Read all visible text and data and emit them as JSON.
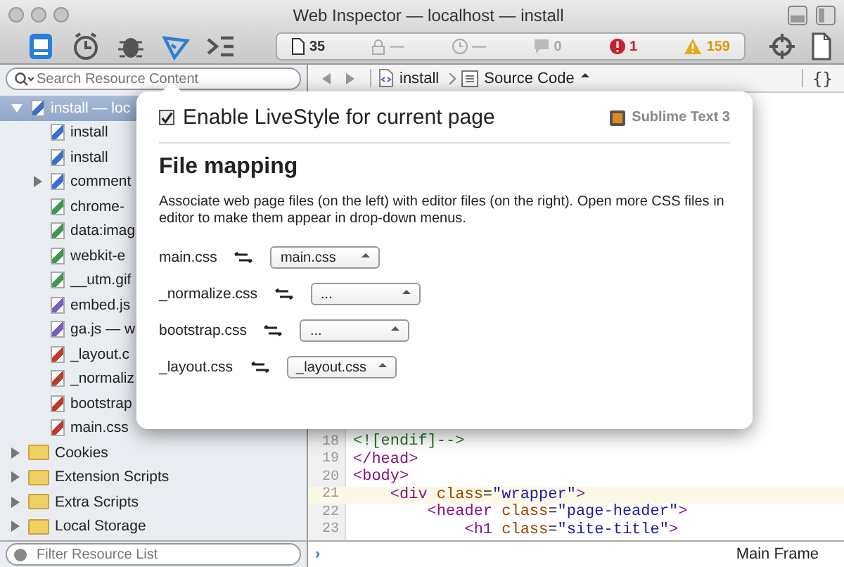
{
  "window": {
    "title": "Web Inspector — localhost — install"
  },
  "toolbar": {
    "tabs": [
      {
        "kind": "resources",
        "selected": true
      },
      {
        "kind": "timeline",
        "selected": false
      },
      {
        "kind": "debugger",
        "selected": false
      },
      {
        "kind": "livestyle",
        "selected": true
      },
      {
        "kind": "console",
        "selected": false
      }
    ],
    "counters": [
      {
        "kind": "documents",
        "text": "35"
      },
      {
        "kind": "security",
        "text": "—"
      },
      {
        "kind": "time",
        "text": "—"
      },
      {
        "kind": "logs",
        "text": "0"
      },
      {
        "kind": "errors",
        "text": "1"
      },
      {
        "kind": "warnings",
        "text": "159"
      }
    ]
  },
  "sidebar": {
    "search": {
      "placeholder": "Search Resource Content"
    },
    "tree": [
      {
        "label": "install — loc",
        "kind": "html",
        "expanded": true,
        "selected": true,
        "children": [
          {
            "label": "install",
            "kind": "html",
            "selected": false
          },
          {
            "label": "install",
            "kind": "html",
            "selected": false
          },
          {
            "label": "comment",
            "kind": "html",
            "expanded": false,
            "selected": false
          },
          {
            "label": "chrome-",
            "kind": "image",
            "selected": false
          },
          {
            "label": "data:imag",
            "kind": "image",
            "selected": false
          },
          {
            "label": "webkit-e",
            "kind": "image",
            "selected": false
          },
          {
            "label": "__utm.gif",
            "kind": "image",
            "selected": false
          },
          {
            "label": "embed.js",
            "kind": "script",
            "selected": false
          },
          {
            "label": "ga.js — w",
            "kind": "script",
            "selected": false
          },
          {
            "label": "_layout.c",
            "kind": "css",
            "selected": false
          },
          {
            "label": "_normaliz",
            "kind": "css",
            "selected": false
          },
          {
            "label": "bootstrap",
            "kind": "css",
            "selected": false
          },
          {
            "label": "main.css",
            "kind": "css",
            "selected": false
          }
        ]
      },
      {
        "label": "Cookies",
        "kind": "folder",
        "expanded": false,
        "selected": false
      },
      {
        "label": "Extension Scripts",
        "kind": "folder",
        "expanded": false,
        "selected": false
      },
      {
        "label": "Extra Scripts",
        "kind": "folder",
        "expanded": false,
        "selected": false
      },
      {
        "label": "Local Storage",
        "kind": "folder",
        "expanded": false,
        "selected": false
      }
    ],
    "filter": {
      "placeholder": "Filter Resource List"
    }
  },
  "path_bar": {
    "crumbs": [
      {
        "kind": "html",
        "text": "install"
      },
      {
        "kind": "source",
        "text": "Source Code"
      }
    ],
    "format_button": "{}"
  },
  "editor": {
    "lines": [
      {
        "number": "18",
        "highlighted": false,
        "tokens": [
          {
            "kind": "comment",
            "text": "<![endif]-->"
          }
        ]
      },
      {
        "number": "19",
        "highlighted": false,
        "tokens": [
          {
            "kind": "tag",
            "text": "</head>"
          }
        ]
      },
      {
        "number": "20",
        "highlighted": false,
        "tokens": [
          {
            "kind": "tag",
            "text": "<body>"
          }
        ]
      },
      {
        "number": "21",
        "highlighted": true,
        "tokens": [
          {
            "kind": "tag",
            "text": "    <div"
          },
          {
            "kind": "attr",
            "text": " class"
          },
          {
            "kind": "text",
            "text": "="
          },
          {
            "kind": "value",
            "text": "\"wrapper\""
          },
          {
            "kind": "tag",
            "text": ">"
          }
        ]
      },
      {
        "number": "22",
        "highlighted": false,
        "tokens": [
          {
            "kind": "tag",
            "text": "        <header"
          },
          {
            "kind": "attr",
            "text": " class"
          },
          {
            "kind": "text",
            "text": "="
          },
          {
            "kind": "value",
            "text": "\"page-header\""
          },
          {
            "kind": "tag",
            "text": ">"
          }
        ]
      },
      {
        "number": "23",
        "highlighted": false,
        "tokens": [
          {
            "kind": "tag",
            "text": "            <h1"
          },
          {
            "kind": "attr",
            "text": " class"
          },
          {
            "kind": "text",
            "text": "="
          },
          {
            "kind": "value",
            "text": "\"site-title\""
          },
          {
            "kind": "tag",
            "text": ">"
          }
        ]
      }
    ]
  },
  "console": {
    "prompt": "›",
    "frame": "Main Frame"
  },
  "popup": {
    "enable": {
      "label": "Enable LiveStyle for current page",
      "checked": true
    },
    "editor_name": "Sublime Text 3",
    "heading": "File mapping",
    "description": "Associate web page files (on the left) with editor files (on the right). Open more CSS files in editor to make them appear in drop-down menus.",
    "mappings": [
      {
        "file": "main.css",
        "selection": "main.css"
      },
      {
        "file": "_normalize.css",
        "selection": "..."
      },
      {
        "file": "bootstrap.css",
        "selection": "..."
      },
      {
        "file": "_layout.css",
        "selection": "_layout.css"
      }
    ]
  }
}
